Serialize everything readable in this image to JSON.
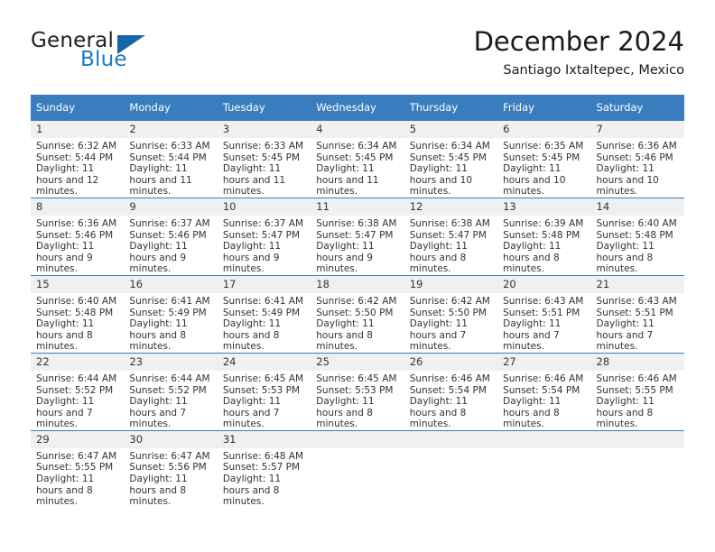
{
  "logo": {
    "word_top": "General",
    "word_bottom": "Blue",
    "triangle_color": "#1565a8",
    "blue_text_color": "#1f7ac0"
  },
  "header": {
    "title": "December 2024",
    "subtitle": "Santiago Ixtaltepec, Mexico"
  },
  "theme": {
    "header_row_bg": "#3a7dbf",
    "daynum_bg": "#f0f0f0",
    "row_border": "#3a7dbf"
  },
  "calendar": {
    "weekday_headers": [
      "Sunday",
      "Monday",
      "Tuesday",
      "Wednesday",
      "Thursday",
      "Friday",
      "Saturday"
    ],
    "weeks": [
      [
        {
          "day": "1",
          "sunrise": "Sunrise: 6:32 AM",
          "sunset": "Sunset: 5:44 PM",
          "daylight": "Daylight: 11 hours and 12 minutes."
        },
        {
          "day": "2",
          "sunrise": "Sunrise: 6:33 AM",
          "sunset": "Sunset: 5:44 PM",
          "daylight": "Daylight: 11 hours and 11 minutes."
        },
        {
          "day": "3",
          "sunrise": "Sunrise: 6:33 AM",
          "sunset": "Sunset: 5:45 PM",
          "daylight": "Daylight: 11 hours and 11 minutes."
        },
        {
          "day": "4",
          "sunrise": "Sunrise: 6:34 AM",
          "sunset": "Sunset: 5:45 PM",
          "daylight": "Daylight: 11 hours and 11 minutes."
        },
        {
          "day": "5",
          "sunrise": "Sunrise: 6:34 AM",
          "sunset": "Sunset: 5:45 PM",
          "daylight": "Daylight: 11 hours and 10 minutes."
        },
        {
          "day": "6",
          "sunrise": "Sunrise: 6:35 AM",
          "sunset": "Sunset: 5:45 PM",
          "daylight": "Daylight: 11 hours and 10 minutes."
        },
        {
          "day": "7",
          "sunrise": "Sunrise: 6:36 AM",
          "sunset": "Sunset: 5:46 PM",
          "daylight": "Daylight: 11 hours and 10 minutes."
        }
      ],
      [
        {
          "day": "8",
          "sunrise": "Sunrise: 6:36 AM",
          "sunset": "Sunset: 5:46 PM",
          "daylight": "Daylight: 11 hours and 9 minutes."
        },
        {
          "day": "9",
          "sunrise": "Sunrise: 6:37 AM",
          "sunset": "Sunset: 5:46 PM",
          "daylight": "Daylight: 11 hours and 9 minutes."
        },
        {
          "day": "10",
          "sunrise": "Sunrise: 6:37 AM",
          "sunset": "Sunset: 5:47 PM",
          "daylight": "Daylight: 11 hours and 9 minutes."
        },
        {
          "day": "11",
          "sunrise": "Sunrise: 6:38 AM",
          "sunset": "Sunset: 5:47 PM",
          "daylight": "Daylight: 11 hours and 9 minutes."
        },
        {
          "day": "12",
          "sunrise": "Sunrise: 6:38 AM",
          "sunset": "Sunset: 5:47 PM",
          "daylight": "Daylight: 11 hours and 8 minutes."
        },
        {
          "day": "13",
          "sunrise": "Sunrise: 6:39 AM",
          "sunset": "Sunset: 5:48 PM",
          "daylight": "Daylight: 11 hours and 8 minutes."
        },
        {
          "day": "14",
          "sunrise": "Sunrise: 6:40 AM",
          "sunset": "Sunset: 5:48 PM",
          "daylight": "Daylight: 11 hours and 8 minutes."
        }
      ],
      [
        {
          "day": "15",
          "sunrise": "Sunrise: 6:40 AM",
          "sunset": "Sunset: 5:48 PM",
          "daylight": "Daylight: 11 hours and 8 minutes."
        },
        {
          "day": "16",
          "sunrise": "Sunrise: 6:41 AM",
          "sunset": "Sunset: 5:49 PM",
          "daylight": "Daylight: 11 hours and 8 minutes."
        },
        {
          "day": "17",
          "sunrise": "Sunrise: 6:41 AM",
          "sunset": "Sunset: 5:49 PM",
          "daylight": "Daylight: 11 hours and 8 minutes."
        },
        {
          "day": "18",
          "sunrise": "Sunrise: 6:42 AM",
          "sunset": "Sunset: 5:50 PM",
          "daylight": "Daylight: 11 hours and 8 minutes."
        },
        {
          "day": "19",
          "sunrise": "Sunrise: 6:42 AM",
          "sunset": "Sunset: 5:50 PM",
          "daylight": "Daylight: 11 hours and 7 minutes."
        },
        {
          "day": "20",
          "sunrise": "Sunrise: 6:43 AM",
          "sunset": "Sunset: 5:51 PM",
          "daylight": "Daylight: 11 hours and 7 minutes."
        },
        {
          "day": "21",
          "sunrise": "Sunrise: 6:43 AM",
          "sunset": "Sunset: 5:51 PM",
          "daylight": "Daylight: 11 hours and 7 minutes."
        }
      ],
      [
        {
          "day": "22",
          "sunrise": "Sunrise: 6:44 AM",
          "sunset": "Sunset: 5:52 PM",
          "daylight": "Daylight: 11 hours and 7 minutes."
        },
        {
          "day": "23",
          "sunrise": "Sunrise: 6:44 AM",
          "sunset": "Sunset: 5:52 PM",
          "daylight": "Daylight: 11 hours and 7 minutes."
        },
        {
          "day": "24",
          "sunrise": "Sunrise: 6:45 AM",
          "sunset": "Sunset: 5:53 PM",
          "daylight": "Daylight: 11 hours and 7 minutes."
        },
        {
          "day": "25",
          "sunrise": "Sunrise: 6:45 AM",
          "sunset": "Sunset: 5:53 PM",
          "daylight": "Daylight: 11 hours and 8 minutes."
        },
        {
          "day": "26",
          "sunrise": "Sunrise: 6:46 AM",
          "sunset": "Sunset: 5:54 PM",
          "daylight": "Daylight: 11 hours and 8 minutes."
        },
        {
          "day": "27",
          "sunrise": "Sunrise: 6:46 AM",
          "sunset": "Sunset: 5:54 PM",
          "daylight": "Daylight: 11 hours and 8 minutes."
        },
        {
          "day": "28",
          "sunrise": "Sunrise: 6:46 AM",
          "sunset": "Sunset: 5:55 PM",
          "daylight": "Daylight: 11 hours and 8 minutes."
        }
      ],
      [
        {
          "day": "29",
          "sunrise": "Sunrise: 6:47 AM",
          "sunset": "Sunset: 5:55 PM",
          "daylight": "Daylight: 11 hours and 8 minutes."
        },
        {
          "day": "30",
          "sunrise": "Sunrise: 6:47 AM",
          "sunset": "Sunset: 5:56 PM",
          "daylight": "Daylight: 11 hours and 8 minutes."
        },
        {
          "day": "31",
          "sunrise": "Sunrise: 6:48 AM",
          "sunset": "Sunset: 5:57 PM",
          "daylight": "Daylight: 11 hours and 8 minutes."
        },
        {
          "day": "",
          "sunrise": "",
          "sunset": "",
          "daylight": ""
        },
        {
          "day": "",
          "sunrise": "",
          "sunset": "",
          "daylight": ""
        },
        {
          "day": "",
          "sunrise": "",
          "sunset": "",
          "daylight": ""
        },
        {
          "day": "",
          "sunrise": "",
          "sunset": "",
          "daylight": ""
        }
      ]
    ]
  }
}
